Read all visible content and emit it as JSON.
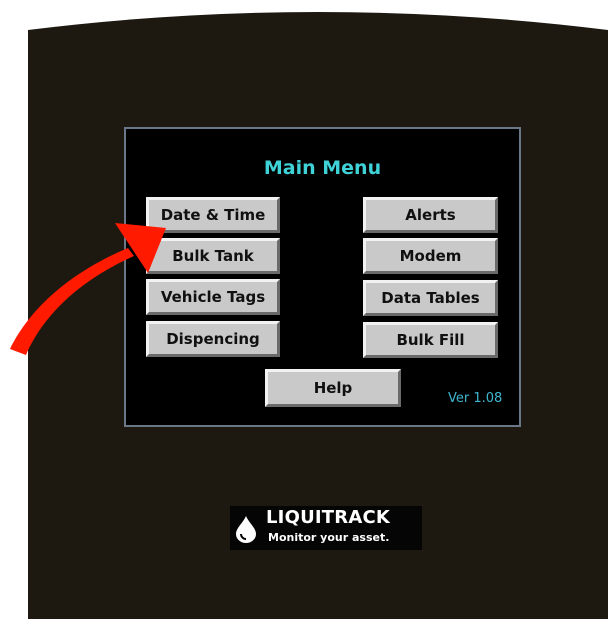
{
  "menu": {
    "title": "Main Menu",
    "left_buttons": [
      "Date & Time",
      "Bulk Tank",
      "Vehicle Tags",
      "Dispencing"
    ],
    "right_buttons": [
      "Alerts",
      "Modem",
      "Data Tables",
      "Bulk Fill"
    ],
    "help_label": "Help",
    "version": "Ver 1.08"
  },
  "logo": {
    "name": "LIQUITRACK",
    "tagline": "Monitor your asset."
  },
  "icons": {
    "logo_mark": "droplet-icon",
    "annotation": "red-arrow-icon"
  },
  "colors": {
    "title": "#3fd3d8",
    "version": "#3fb6cf",
    "button_face": "#c9c9c9",
    "screen_border": "#6a7788",
    "housing": "#1d1911",
    "arrow": "#ff0000"
  }
}
